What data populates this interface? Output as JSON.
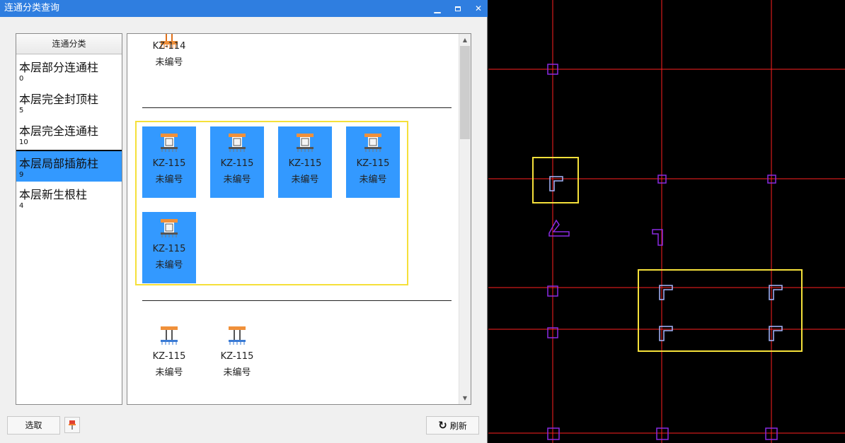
{
  "window": {
    "title": "连通分类查询"
  },
  "categories": {
    "header": "连通分类",
    "items": [
      {
        "name": "本层部分连通柱",
        "count": "0"
      },
      {
        "name": "本层完全封顶柱",
        "count": "5"
      },
      {
        "name": "本层完全连通柱",
        "count": "10"
      },
      {
        "name": "本层局部插筋柱",
        "count": "9"
      },
      {
        "name": "本层新生根柱",
        "count": "4"
      }
    ]
  },
  "preview": {
    "top_tile": {
      "code": "KZ-114",
      "num": "未编号"
    },
    "selected_tiles": [
      {
        "code": "KZ-115",
        "num": "未编号"
      },
      {
        "code": "KZ-115",
        "num": "未编号"
      },
      {
        "code": "KZ-115",
        "num": "未编号"
      },
      {
        "code": "KZ-115",
        "num": "未编号"
      },
      {
        "code": "KZ-115",
        "num": "未编号"
      }
    ],
    "bottom_tiles": [
      {
        "code": "KZ-115",
        "num": "未编号"
      },
      {
        "code": "KZ-115",
        "num": "未编号"
      }
    ]
  },
  "buttons": {
    "select": "选取",
    "refresh": "刷新"
  },
  "colors": {
    "title_bar": "#2f7ee0",
    "selection": "#3399ff",
    "highlight_box": "#f5e03a",
    "cad_grid": "#ff2020",
    "cad_column": "#8a2be2"
  }
}
